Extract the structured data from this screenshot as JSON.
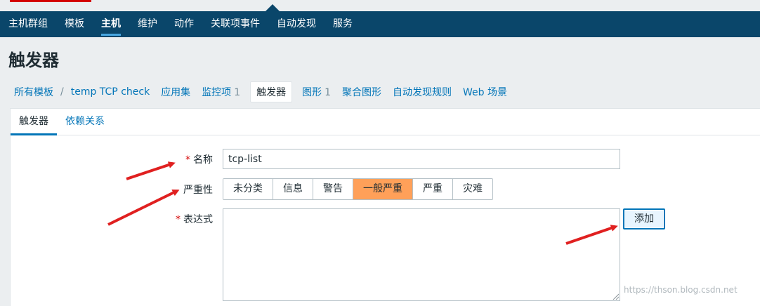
{
  "topnav": {
    "items": [
      {
        "label": "主机群组"
      },
      {
        "label": "模板"
      },
      {
        "label": "主机"
      },
      {
        "label": "维护"
      },
      {
        "label": "动作"
      },
      {
        "label": "关联项事件"
      },
      {
        "label": "自动发现"
      },
      {
        "label": "服务"
      }
    ],
    "active_index": 2
  },
  "page": {
    "title": "触发器"
  },
  "breadcrumb": {
    "all_templates": "所有模板",
    "separator": "/",
    "template_name": "temp TCP check",
    "applications": "应用集",
    "items_label": "监控项",
    "items_count": "1",
    "triggers": "触发器",
    "graphs_label": "图形",
    "graphs_count": "1",
    "screens": "聚合图形",
    "discovery_rules": "自动发现规则",
    "web_scenarios": "Web 场景"
  },
  "tabs": {
    "trigger": "触发器",
    "dependencies": "依赖关系"
  },
  "form": {
    "required_mark": "*",
    "name_label": "名称",
    "name_value": "tcp-list",
    "severity_label": "严重性",
    "severity_options": [
      "未分类",
      "信息",
      "警告",
      "一般严重",
      "严重",
      "灾难"
    ],
    "severity_selected": "一般严重",
    "expression_label": "表达式",
    "expression_value": "",
    "add_button": "添加"
  },
  "colors": {
    "nav_bg": "#0a466a",
    "selected_severity": "#ffa059",
    "link": "#0275b8",
    "arrow": "#e02020"
  },
  "watermark": "https://thson.blog.csdn.net"
}
